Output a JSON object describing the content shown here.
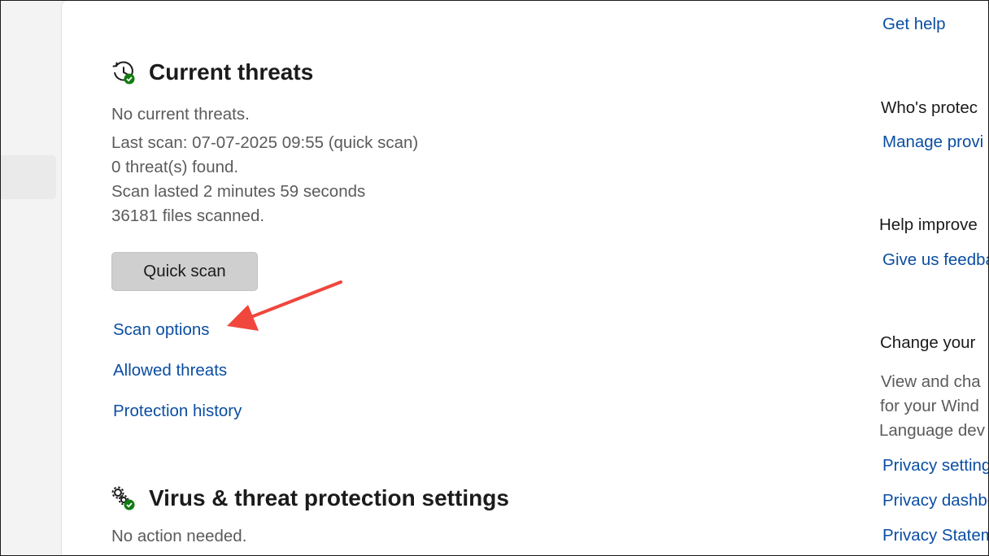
{
  "current_threats": {
    "title": "Current threats",
    "status": "No current threats.",
    "last_scan": "Last scan: 07-07-2025 09:55 (quick scan)",
    "threats_found": "0 threat(s) found.",
    "scan_duration": "Scan lasted 2 minutes 59 seconds",
    "files_scanned": "36181 files scanned.",
    "quick_scan_label": "Quick scan",
    "links": {
      "scan_options": "Scan options",
      "allowed_threats": "Allowed threats",
      "protection_history": "Protection history"
    },
    "icon": "history-clock-check-icon"
  },
  "virus_settings": {
    "title": "Virus & threat protection settings",
    "status": "No action needed.",
    "icon": "gears-check-icon"
  },
  "sidebar": {
    "get_help": "Get help",
    "whos_protecting_heading": "Who's protec",
    "manage_providers": "Manage provi",
    "help_improve_heading": "Help improve",
    "give_feedback": "Give us feedba",
    "change_privacy_heading": "Change your",
    "privacy_text_1": "View and cha",
    "privacy_text_2": "for your Wind",
    "privacy_text_3": "Language dev",
    "privacy_settings": "Privacy setting",
    "privacy_dashboard": "Privacy dashbo",
    "privacy_statement": "Privacy Statem"
  },
  "annotation": {
    "arrow_color": "#f0463c"
  },
  "colors": {
    "link": "#0b4ea2",
    "check_green": "#107c10"
  }
}
